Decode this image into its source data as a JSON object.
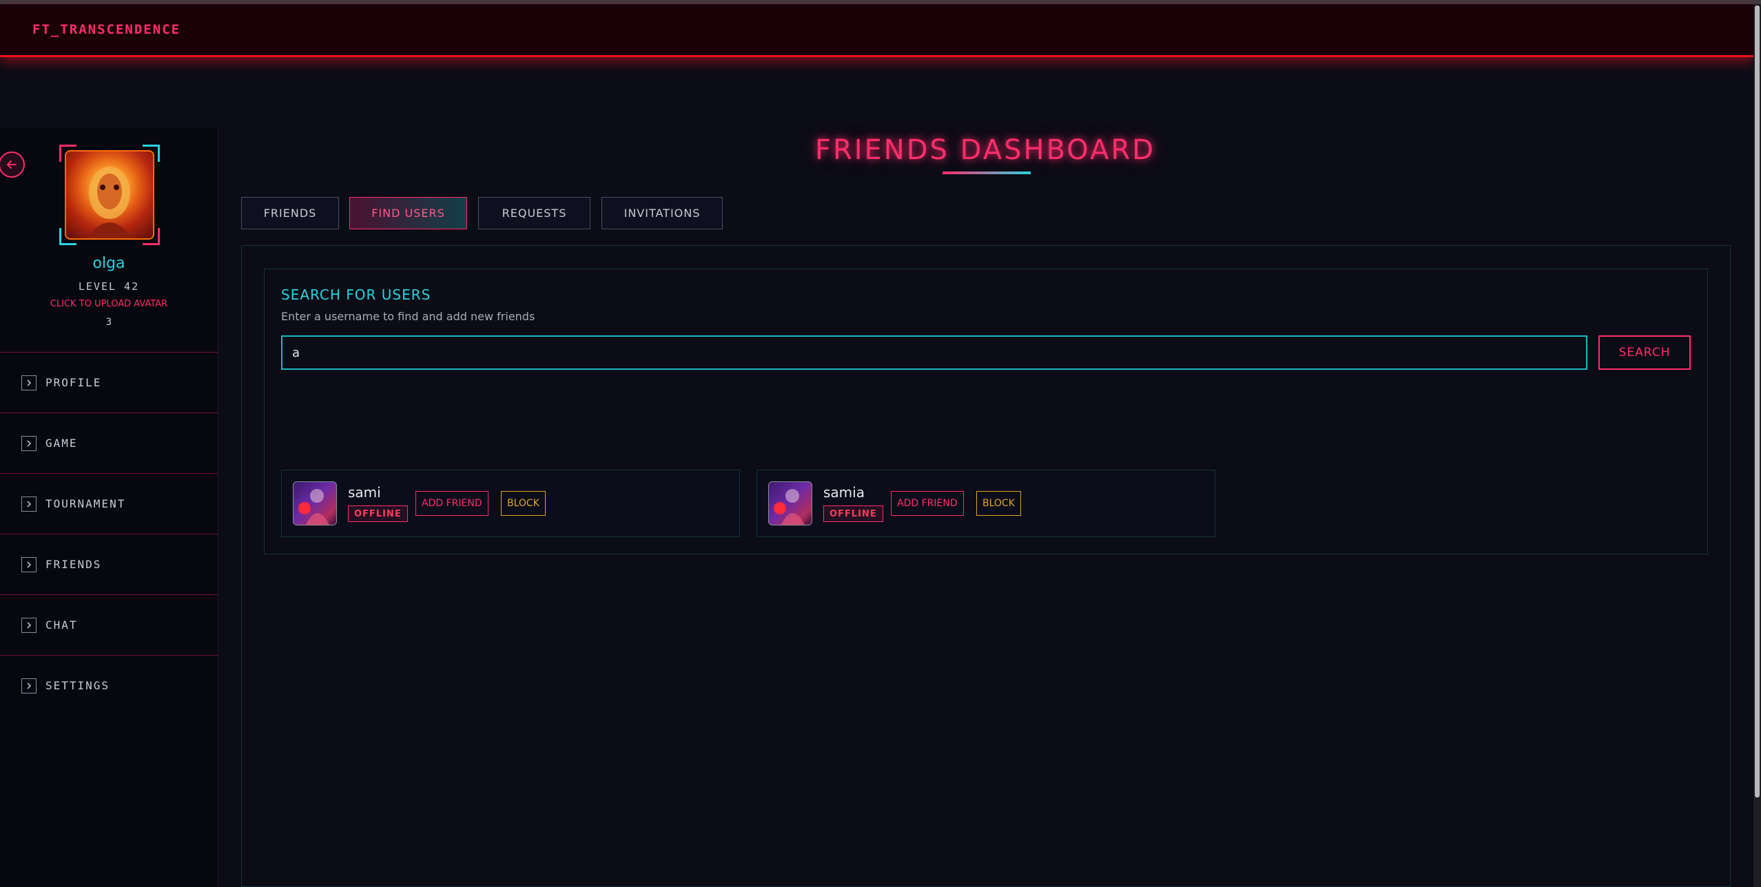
{
  "app": {
    "brand": "FT_TRANSCENDENCE"
  },
  "profile": {
    "username": "olga",
    "level": "LEVEL 42",
    "upload_label": "CLICK TO UPLOAD AVATAR",
    "count": "3"
  },
  "nav": {
    "items": [
      {
        "label": "PROFILE"
      },
      {
        "label": "GAME"
      },
      {
        "label": "TOURNAMENT"
      },
      {
        "label": "FRIENDS"
      },
      {
        "label": "CHAT"
      },
      {
        "label": "SETTINGS"
      }
    ]
  },
  "page": {
    "title": "FRIENDS DASHBOARD"
  },
  "tabs": [
    {
      "label": "FRIENDS"
    },
    {
      "label": "FIND USERS",
      "active": true
    },
    {
      "label": "REQUESTS"
    },
    {
      "label": "INVITATIONS"
    }
  ],
  "search": {
    "title": "SEARCH FOR USERS",
    "subtitle": "Enter a username to find and add new friends",
    "value": "a",
    "button_label": "SEARCH"
  },
  "results": [
    {
      "name": "sami",
      "status": "OFFLINE",
      "add_label": "ADD FRIEND",
      "block_label": "BLOCK"
    },
    {
      "name": "samia",
      "status": "OFFLINE",
      "add_label": "ADD FRIEND",
      "block_label": "BLOCK"
    }
  ],
  "colors": {
    "accent_pink": "#ff2d6b",
    "accent_cyan": "#2ad4e0",
    "warning": "#e2a52a",
    "header_glow": "#e8121c",
    "background": "#0b0c16"
  },
  "icons": {
    "back": "arrow-left-icon",
    "nav": "chevron-right-icon"
  }
}
